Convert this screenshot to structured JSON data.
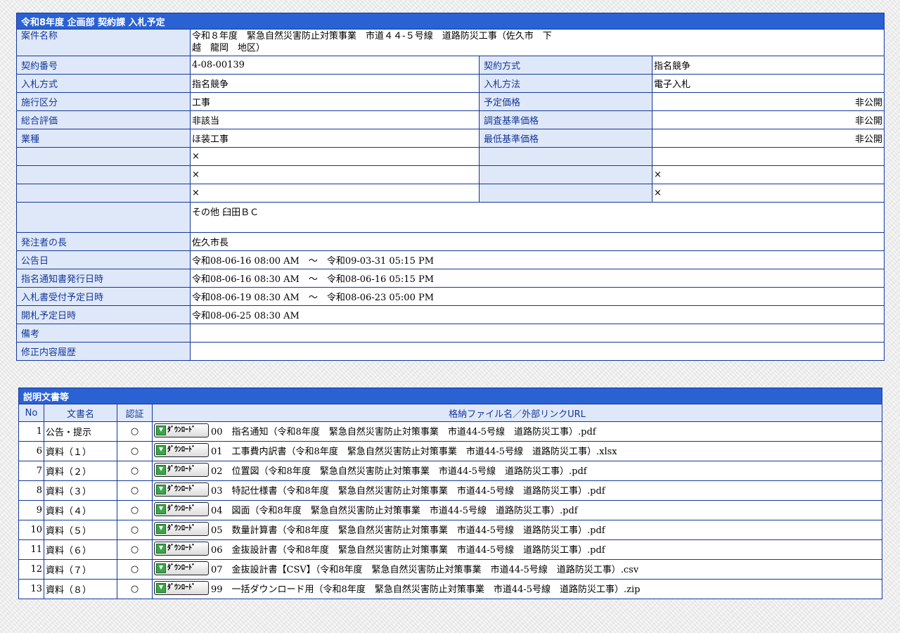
{
  "info": {
    "title": "令和8年度 企画部 契約課 入札予定",
    "labels": {
      "case_name": "案件名称",
      "contract_no": "契約番号",
      "contract_method": "契約方式",
      "bid_type": "入札方式",
      "bid_method": "入札方法",
      "category": "施行区分",
      "planned_price": "予定価格",
      "overall": "総合評価",
      "survey_price": "調査基準価格",
      "industry": "業種",
      "min_price": "最低基準価格",
      "orderer": "発注者の長",
      "notice_date": "公告日",
      "nomination_date": "指名通知書発行日時",
      "bid_receipt": "入札書受付予定日時",
      "opening": "開札予定日時",
      "remarks": "備考",
      "history": "修正内容履歴"
    },
    "values": {
      "case_name_line1": "令和８年度　緊急自然災害防止対策事業　市道４４-５号線　道路防災工事（佐久市　下",
      "case_name_line2": "越　龍岡　地区）",
      "contract_no": "4-08-00139",
      "contract_method": "指名競争",
      "bid_type": "指名競争",
      "bid_method": "電子入札",
      "category": "工事",
      "planned_price": "非公開",
      "overall": "非該当",
      "survey_price": "非公開",
      "industry": "ほ装工事",
      "min_price": "非公開",
      "x1": "×",
      "x2": "×",
      "x2b": "×",
      "x3": "×",
      "x3b": "×",
      "other": "その他 臼田ＢＣ",
      "orderer": "佐久市長",
      "notice_date": "令和08-06-16 08:00 AM　～　令和09-03-31 05:15 PM",
      "nomination_date": "令和08-06-16 08:30 AM　～　令和08-06-16 05:15 PM",
      "bid_receipt": "令和08-06-19 08:30 AM　～　令和08-06-23 05:00 PM",
      "opening": "令和08-06-25 08:30 AM",
      "remarks": "",
      "history": ""
    }
  },
  "docs": {
    "title": "説明文書等",
    "headers": {
      "no": "No",
      "name": "文書名",
      "auth": "認証",
      "file": "格納ファイル名／外部リンクURL"
    },
    "button_label": "ﾀﾞｳﾝﾛｰﾄﾞ",
    "rows": [
      {
        "no": "1",
        "name": "公告・提示",
        "auth": "○",
        "file": "00　指名通知（令和8年度　緊急自然災害防止対策事業　市道44-5号線　道路防災工事）.pdf"
      },
      {
        "no": "6",
        "name": "資料（１）",
        "auth": "○",
        "file": "01　工事費内訳書（令和8年度　緊急自然災害防止対策事業　市道44-5号線　道路防災工事）.xlsx"
      },
      {
        "no": "7",
        "name": "資料（２）",
        "auth": "○",
        "file": "02　位置図（令和8年度　緊急自然災害防止対策事業　市道44-5号線　道路防災工事）.pdf"
      },
      {
        "no": "8",
        "name": "資料（３）",
        "auth": "○",
        "file": "03　特記仕様書（令和8年度　緊急自然災害防止対策事業　市道44-5号線　道路防災工事）.pdf"
      },
      {
        "no": "9",
        "name": "資料（４）",
        "auth": "○",
        "file": "04　図面（令和8年度　緊急自然災害防止対策事業　市道44-5号線　道路防災工事）.pdf"
      },
      {
        "no": "10",
        "name": "資料（５）",
        "auth": "○",
        "file": "05　数量計算書（令和8年度　緊急自然災害防止対策事業　市道44-5号線　道路防災工事）.pdf"
      },
      {
        "no": "11",
        "name": "資料（６）",
        "auth": "○",
        "file": "06　金抜設計書（令和8年度　緊急自然災害防止対策事業　市道44-5号線　道路防災工事）.pdf"
      },
      {
        "no": "12",
        "name": "資料（７）",
        "auth": "○",
        "file": "07　金抜設計書【CSV】（令和8年度　緊急自然災害防止対策事業　市道44-5号線　道路防災工事）.csv"
      },
      {
        "no": "13",
        "name": "資料（８）",
        "auth": "○",
        "file": "99　一括ダウンロード用（令和8年度　緊急自然災害防止対策事業　市道44-5号線　道路防災工事）.zip"
      }
    ]
  },
  "colors": {
    "header_bg": "#2a62d4",
    "label_bg": "#dfe8f8",
    "label_text": "#14389a",
    "border": "#14389a"
  }
}
